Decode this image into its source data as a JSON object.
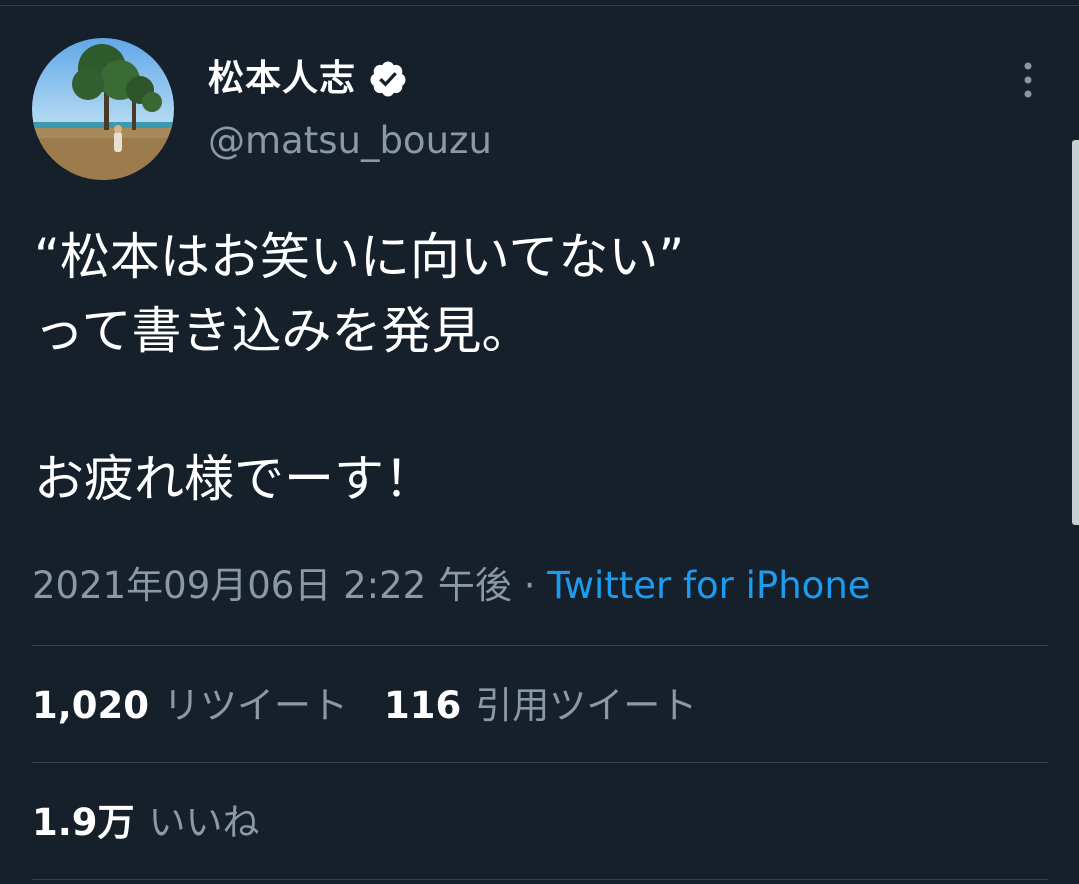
{
  "user": {
    "display_name": "松本人志",
    "handle": "@matsu_bouzu",
    "verified": true,
    "avatar_icon": "profile-photo-avatar"
  },
  "menu": {
    "icon": "more-vertical-icon"
  },
  "tweet": {
    "lines": [
      "“松本はお笑いに向いてない”",
      "って書き込みを発見。",
      "",
      "お疲れ様でーす！"
    ]
  },
  "meta": {
    "timestamp": "2021年09月06日 2:22 午後",
    "separator": "·",
    "source": "Twitter for iPhone"
  },
  "stats": {
    "retweets_count": "1,020",
    "retweets_label": "リツイート",
    "quotes_count": "116",
    "quotes_label": "引用ツイート",
    "likes_count": "1.9万",
    "likes_label": "いいね"
  },
  "colors": {
    "background": "#15202b",
    "secondary_text": "#8b98a5",
    "link": "#1d9bf0",
    "divider": "#38444d"
  }
}
